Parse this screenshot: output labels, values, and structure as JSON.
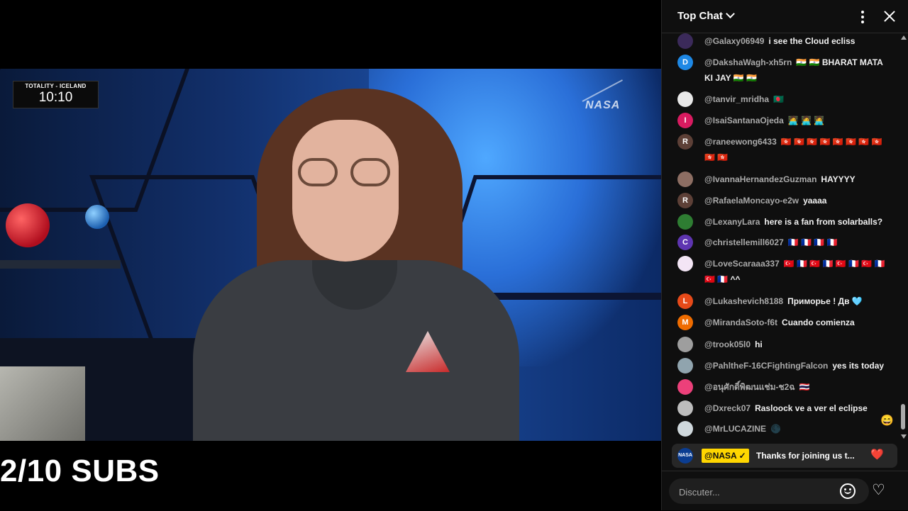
{
  "video": {
    "badge_label": "TOTALITY - ICELAND",
    "badge_time": "10:10",
    "watermark": "NASA",
    "overlay_text": "2/10 SUBS"
  },
  "chat": {
    "title": "Top Chat",
    "messages": [
      {
        "author": "@Galaxy06949",
        "text": "i see the Cloud ecliss",
        "avatar": "",
        "color": "#3b2a5a"
      },
      {
        "author": "@DakshaWagh-xh5rn",
        "text": "🇮🇳 🇮🇳 BHARAT MATA KI JAY 🇮🇳 🇮🇳",
        "avatar": "D",
        "color": "#1e88e5"
      },
      {
        "author": "@tanvir_mridha",
        "text": "🇧🇩",
        "avatar": "",
        "color": "#e8e8e8"
      },
      {
        "author": "@IsaiSantanaOjeda",
        "text": "🧑‍💻 🧑‍💻 🧑‍💻",
        "avatar": "I",
        "color": "#d81b60"
      },
      {
        "author": "@raneewong6433",
        "text": "🇭🇰 🇭🇰 🇭🇰 🇭🇰 🇭🇰 🇭🇰 🇭🇰 🇭🇰 🇭🇰 🇭🇰",
        "avatar": "R",
        "color": "#5d4037"
      },
      {
        "author": "@IvannaHernandezGuzman",
        "text": "HAYYYY",
        "avatar": "",
        "color": "#8d6e63"
      },
      {
        "author": "@RafaelaMoncayo-e2w",
        "text": "yaaaa",
        "avatar": "R",
        "color": "#5d4037"
      },
      {
        "author": "@LexanyLara",
        "text": "here is a fan from solarballs?",
        "avatar": "",
        "color": "#2e7d32"
      },
      {
        "author": "@christellemill6027",
        "text": "🇫🇷 🇫🇷 🇫🇷 🇫🇷",
        "avatar": "C",
        "color": "#5e35b1"
      },
      {
        "author": "@LoveScaraaa337",
        "text": "🇹🇷 🇫🇷 🇹🇷 🇫🇷 🇹🇷 🇫🇷 🇹🇷 🇫🇷 🇹🇷 🇫🇷 ^^",
        "avatar": "",
        "color": "#f3e5f5"
      },
      {
        "author": "@Lukashevich8188",
        "text": "Приморье ! Дв 🩵",
        "avatar": "L",
        "color": "#e64a19"
      },
      {
        "author": "@MirandaSoto-f6t",
        "text": "Cuando comienza",
        "avatar": "M",
        "color": "#ef6c00"
      },
      {
        "author": "@trook05l0",
        "text": "hi",
        "avatar": "",
        "color": "#9e9e9e"
      },
      {
        "author": "@PahltheF-16CFightingFalcon",
        "text": "yes its today",
        "avatar": "",
        "color": "#90a4ae"
      },
      {
        "author": "@อนุศักดิ์พิฒนแช่ม-ช2ฉ",
        "text": "🇹🇭",
        "avatar": "",
        "color": "#ec407a"
      },
      {
        "author": "@Dxreck07",
        "text": "Rasloock ve a ver el eclipse",
        "avatar": "",
        "color": "#bdbdbd"
      },
      {
        "author": "@MrLUCAZINE",
        "text": "🌑",
        "avatar": "",
        "color": "#cfd8dc"
      }
    ],
    "floating_emoji": "😄",
    "pinned": {
      "author": "@NASA ✓",
      "text": "Thanks for joining us t...",
      "avatar": "NASA",
      "heart": "❤️"
    },
    "input_placeholder": "Discuter...",
    "colors": {
      "background": "#0f0f0f",
      "pinned_author_bg": "#ffd600",
      "author_text": "#aaaaaa"
    }
  }
}
